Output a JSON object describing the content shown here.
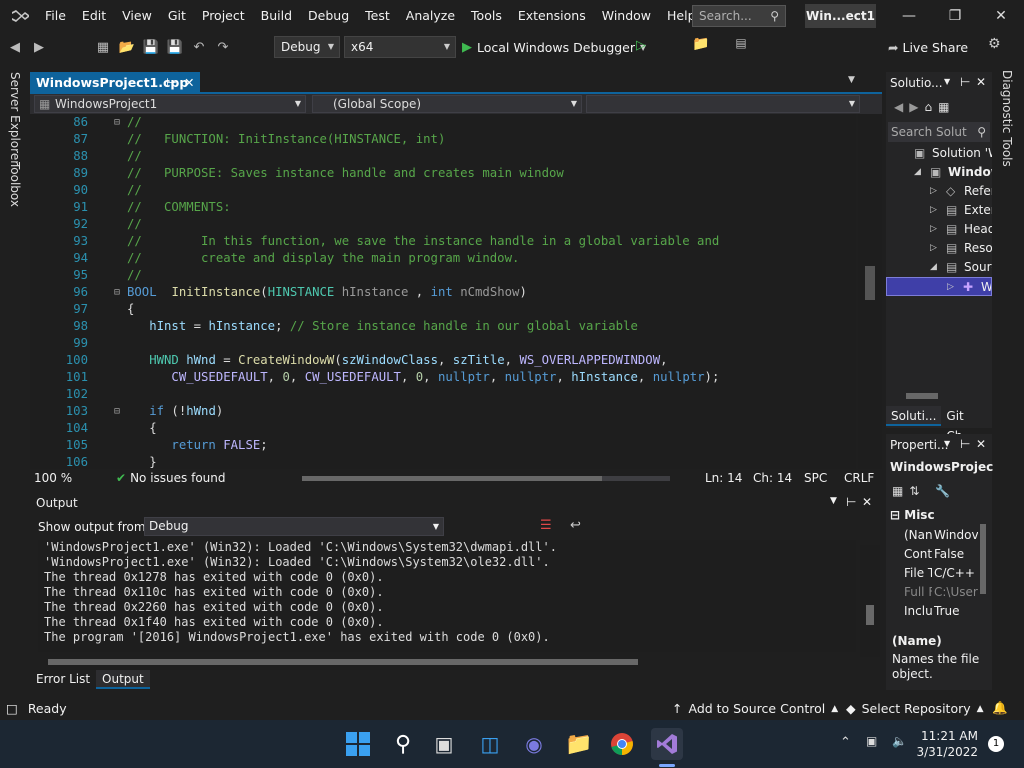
{
  "titlebar": {
    "menu": [
      "File",
      "Edit",
      "View",
      "Git",
      "Project",
      "Build",
      "Debug",
      "Test",
      "Analyze",
      "Tools",
      "Extensions",
      "Window",
      "Help"
    ],
    "search_placeholder": "Search...",
    "window_title": "Win...ect1"
  },
  "toolbar": {
    "config": "Debug",
    "platform": "x64",
    "run_label": "Local Windows Debugger",
    "live_share": "Live Share"
  },
  "left_strip": {
    "server_explorer": "Server Explorer",
    "toolbox": "Toolbox"
  },
  "editor": {
    "tab_label": "WindowsProject1.cpp",
    "project_combo": "WindowsProject1",
    "scope_combo": "(Global Scope)",
    "lines": [
      {
        "n": "86",
        "s": [
          [
            "cm",
            "//"
          ]
        ]
      },
      {
        "n": "87",
        "s": [
          [
            "cm",
            "//   FUNCTION: InitInstance(HINSTANCE, int)"
          ]
        ]
      },
      {
        "n": "88",
        "s": [
          [
            "cm",
            "//"
          ]
        ]
      },
      {
        "n": "89",
        "s": [
          [
            "cm",
            "//   PURPOSE: Saves instance handle and creates main window"
          ]
        ]
      },
      {
        "n": "90",
        "s": [
          [
            "cm",
            "//"
          ]
        ]
      },
      {
        "n": "91",
        "s": [
          [
            "cm",
            "//   COMMENTS:"
          ]
        ]
      },
      {
        "n": "92",
        "s": [
          [
            "cm",
            "//"
          ]
        ]
      },
      {
        "n": "93",
        "s": [
          [
            "cm",
            "//        In this function, we save the instance handle in a global variable and"
          ]
        ]
      },
      {
        "n": "94",
        "s": [
          [
            "cm",
            "//        create and display the main program window."
          ]
        ]
      },
      {
        "n": "95",
        "s": [
          [
            "cm",
            "//"
          ]
        ]
      },
      {
        "n": "96",
        "s": [
          [
            "kw",
            "BOOL"
          ],
          [
            "",
            "  "
          ],
          [
            "fn",
            "InitInstance"
          ],
          [
            "",
            "("
          ],
          [
            "ty",
            "HINSTANCE"
          ],
          [
            "pm",
            " hInstance"
          ],
          [
            "",
            " , "
          ],
          [
            "kw",
            "int"
          ],
          [
            "pm",
            " nCmdShow"
          ],
          [
            "",
            ")"
          ]
        ]
      },
      {
        "n": "97",
        "s": [
          [
            "",
            "{"
          ]
        ]
      },
      {
        "n": "98",
        "s": [
          [
            "var",
            "   hInst"
          ],
          [
            "",
            " = "
          ],
          [
            "var",
            "hInstance"
          ],
          [
            "",
            "; "
          ],
          [
            "cm",
            "// Store instance handle in our global variable"
          ]
        ]
      },
      {
        "n": "99",
        "s": [
          [
            "",
            ""
          ]
        ]
      },
      {
        "n": "100",
        "s": [
          [
            "ty",
            "   HWND"
          ],
          [
            "",
            " "
          ],
          [
            "var",
            "hWnd"
          ],
          [
            "",
            " = "
          ],
          [
            "fn",
            "CreateWindowW"
          ],
          [
            "",
            "("
          ],
          [
            "var",
            "szWindowClass"
          ],
          [
            "",
            ", "
          ],
          [
            "var",
            "szTitle"
          ],
          [
            "",
            ", "
          ],
          [
            "mc",
            "WS_OVERLAPPEDWINDOW"
          ],
          [
            "",
            ","
          ]
        ]
      },
      {
        "n": "101",
        "s": [
          [
            "mc",
            "      CW_USEDEFAULT"
          ],
          [
            "",
            ", "
          ],
          [
            "nu",
            "0"
          ],
          [
            "",
            ", "
          ],
          [
            "mc",
            "CW_USEDEFAULT"
          ],
          [
            "",
            ", "
          ],
          [
            "nu",
            "0"
          ],
          [
            "",
            ", "
          ],
          [
            "kw",
            "nullptr"
          ],
          [
            "",
            ", "
          ],
          [
            "kw",
            "nullptr"
          ],
          [
            "",
            ", "
          ],
          [
            "var",
            "hInstance"
          ],
          [
            "",
            ", "
          ],
          [
            "kw",
            "nullptr"
          ],
          [
            "",
            ");"
          ]
        ]
      },
      {
        "n": "102",
        "s": [
          [
            "",
            ""
          ]
        ]
      },
      {
        "n": "103",
        "s": [
          [
            "kw",
            "   if"
          ],
          [
            "",
            " (!"
          ],
          [
            "var",
            "hWnd"
          ],
          [
            "",
            ")"
          ]
        ]
      },
      {
        "n": "104",
        "s": [
          [
            "",
            "   {"
          ]
        ]
      },
      {
        "n": "105",
        "s": [
          [
            "kw",
            "      return"
          ],
          [
            "",
            " "
          ],
          [
            "mc",
            "FALSE"
          ],
          [
            "",
            ";"
          ]
        ]
      },
      {
        "n": "106",
        "s": [
          [
            "",
            "   }"
          ]
        ]
      }
    ],
    "zoom": "100 %",
    "issues": "No issues found",
    "ln": "Ln: 14",
    "ch": "Ch: 14",
    "spc": "SPC",
    "crlf": "CRLF"
  },
  "output": {
    "title": "Output",
    "show_from_label": "Show output from:",
    "source": "Debug",
    "lines": [
      "'WindowsProject1.exe' (Win32): Loaded 'C:\\Windows\\System32\\dwmapi.dll'.",
      "'WindowsProject1.exe' (Win32): Loaded 'C:\\Windows\\System32\\ole32.dll'.",
      "The thread 0x1278 has exited with code 0 (0x0).",
      "The thread 0x110c has exited with code 0 (0x0).",
      "The thread 0x2260 has exited with code 0 (0x0).",
      "The thread 0x1f40 has exited with code 0 (0x0).",
      "The program '[2016] WindowsProject1.exe' has exited with code 0 (0x0)."
    ],
    "tabs": [
      "Error List",
      "Output"
    ]
  },
  "solution": {
    "title": "Solutio...",
    "search_placeholder": "Search Solut",
    "items": [
      "Solution 'Win",
      "WindowsP",
      "Referen",
      "Externa",
      "Heade",
      "Resour",
      "Source",
      "Win"
    ],
    "tabs": [
      "Soluti...",
      "Git Ch..."
    ]
  },
  "properties": {
    "title": "Properti...",
    "object": "WindowsProjec",
    "category": "Misc",
    "rows": [
      [
        "(Nan",
        "Windov"
      ],
      [
        "Cont",
        "False"
      ],
      [
        "File T",
        "C/C++"
      ],
      [
        "Full F",
        "C:\\User"
      ],
      [
        "Inclu",
        "True"
      ]
    ],
    "desc_title": "(Name)",
    "desc_text": "Names the file object."
  },
  "right_strip": {
    "label": "Diagnostic Tools"
  },
  "statusbar": {
    "ready": "Ready",
    "source_control": "Add to Source Control",
    "repo": "Select Repository"
  },
  "taskbar": {
    "time": "11:21 AM",
    "date": "3/31/2022",
    "notif": "1"
  },
  "colors": {
    "accent": "#0e639c",
    "selection": "#3f3fa8",
    "vs_purple": "#865fc5"
  }
}
